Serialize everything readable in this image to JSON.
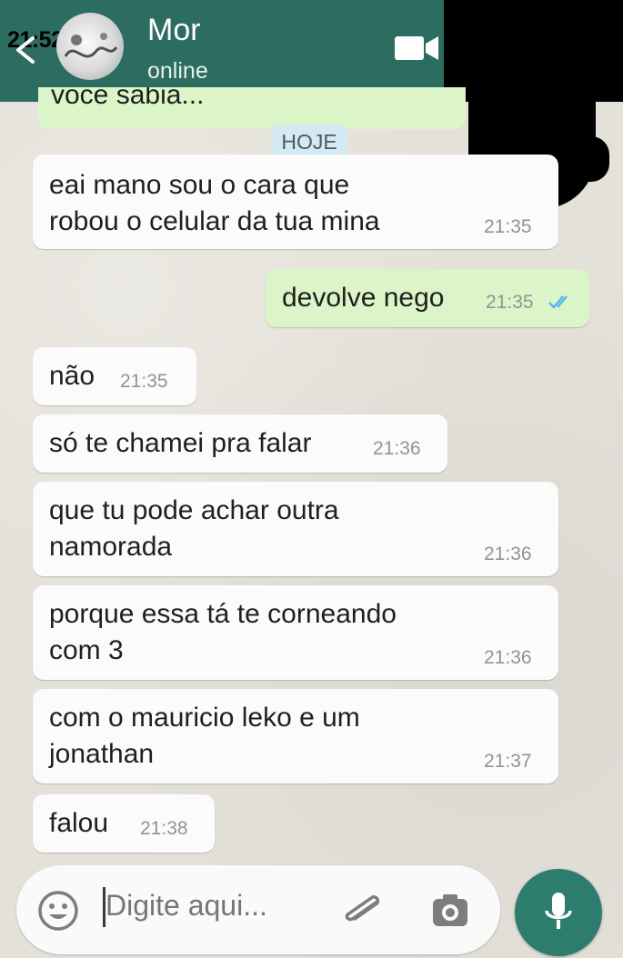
{
  "status_bar": {
    "time": "21:52"
  },
  "header": {
    "contact_name": "Mor",
    "contact_status": "online"
  },
  "previous_message_fragment": "voce sabia...",
  "date_chip": "HOJE",
  "messages": [
    {
      "direction": "incoming",
      "text": "eai mano sou o cara que\nrobou o celular da tua mina",
      "time": "21:35"
    },
    {
      "direction": "outgoing",
      "text": "devolve nego",
      "time": "21:35",
      "read": true
    },
    {
      "direction": "incoming",
      "text": "não",
      "time": "21:35"
    },
    {
      "direction": "incoming",
      "text": "só te chamei pra falar",
      "time": "21:36"
    },
    {
      "direction": "incoming",
      "text": "que tu pode achar outra\nnamorada",
      "time": "21:36"
    },
    {
      "direction": "incoming",
      "text": "porque essa tá te corneando\ncom 3",
      "time": "21:36"
    },
    {
      "direction": "incoming",
      "text": "com o mauricio leko e um\njonathan",
      "time": "21:37"
    },
    {
      "direction": "incoming",
      "text": "falou",
      "time": "21:38"
    }
  ],
  "composer": {
    "placeholder": "Digite aqui..."
  },
  "colors": {
    "header": "#2d6d61",
    "outgoing_bubble": "#dcf5c8",
    "incoming_bubble": "#fbfbfb",
    "accent": "#2d7d6e",
    "read_ticks": "#4fb6ec"
  },
  "icons": [
    "back-arrow-icon",
    "location-arrow-icon",
    "video-call-icon",
    "emoji-icon",
    "attach-icon",
    "camera-icon",
    "mic-icon",
    "read-ticks-icon"
  ]
}
